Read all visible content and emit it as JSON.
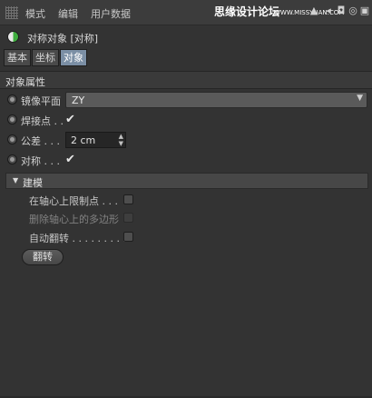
{
  "menu": {
    "items": [
      "模式",
      "编辑",
      "用户数据"
    ],
    "watermark": "思缘设计论坛",
    "watermark_sub": "WWW.MISSYUAN.COM"
  },
  "object": {
    "title": "对称对象 [对称]"
  },
  "tabs": [
    {
      "label": "基本",
      "active": false
    },
    {
      "label": "坐标",
      "active": false
    },
    {
      "label": "对象",
      "active": true
    }
  ],
  "section": {
    "title": "对象属性"
  },
  "props": {
    "mirror_plane_label": "镜像平面",
    "mirror_plane_value": "ZY",
    "weld_label": "焊接点 . .",
    "weld_checked": true,
    "tolerance_label": "公差 . . .",
    "tolerance_value": "2 cm",
    "symmetry_label": "对称 . . .",
    "symmetry_checked": true
  },
  "modeling": {
    "title": "建模",
    "options": [
      {
        "label": "在轴心上限制点 . . .",
        "enabled": true,
        "checked": false
      },
      {
        "label": "删除轴心上的多边形",
        "enabled": false,
        "checked": false
      },
      {
        "label": "自动翻转 . . . . . . . . .",
        "enabled": true,
        "checked": false
      }
    ],
    "flip_button": "翻转"
  },
  "check_glyph": "✔",
  "colors": {
    "background": "#333333",
    "active_tab": "#7b8fa5",
    "object_icon_green": "#3fae3f"
  }
}
